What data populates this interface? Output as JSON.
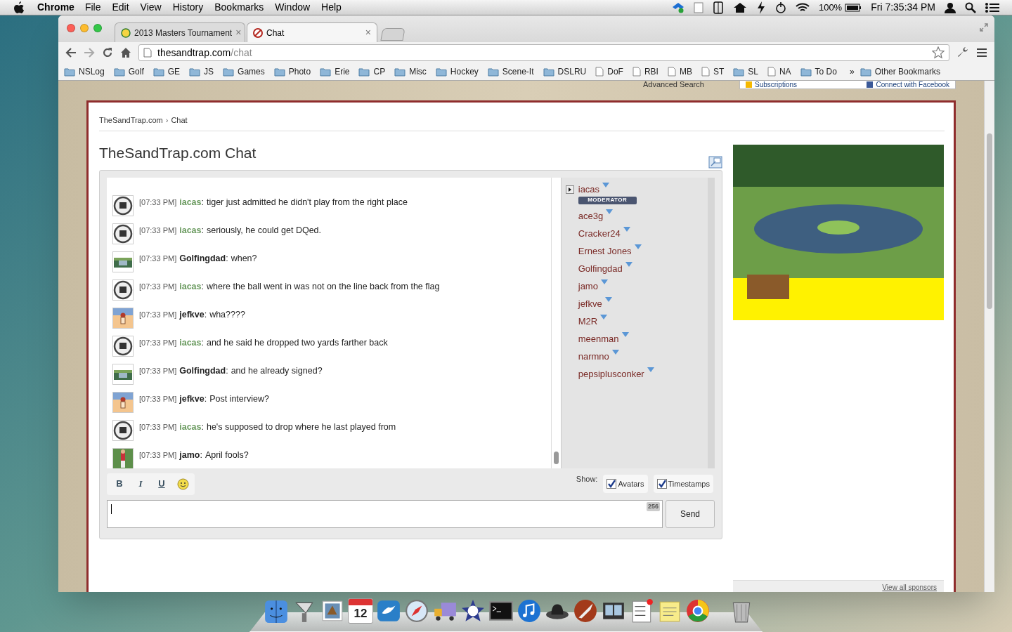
{
  "menubar": {
    "app": "Chrome",
    "items": [
      "File",
      "Edit",
      "View",
      "History",
      "Bookmarks",
      "Window",
      "Help"
    ],
    "battery": "100%",
    "clock": "Fri 7:35:34 PM"
  },
  "browser": {
    "tabs": [
      {
        "title": "2013 Masters Tournament",
        "selected": false,
        "close": "×"
      },
      {
        "title": "Chat",
        "selected": true,
        "close": "×"
      }
    ],
    "url": {
      "host": "thesandtrap.com",
      "path": "/chat"
    },
    "bookmarks": [
      {
        "label": "NSLog",
        "kind": "folder"
      },
      {
        "label": "Golf",
        "kind": "folder"
      },
      {
        "label": "GE",
        "kind": "folder"
      },
      {
        "label": "JS",
        "kind": "folder"
      },
      {
        "label": "Games",
        "kind": "folder"
      },
      {
        "label": "Photo",
        "kind": "folder"
      },
      {
        "label": "Erie",
        "kind": "folder"
      },
      {
        "label": "CP",
        "kind": "folder"
      },
      {
        "label": "Misc",
        "kind": "folder"
      },
      {
        "label": "Hockey",
        "kind": "folder"
      },
      {
        "label": "Scene-It",
        "kind": "folder"
      },
      {
        "label": "DSLRU",
        "kind": "folder"
      },
      {
        "label": "DoF",
        "kind": "page"
      },
      {
        "label": "RBI",
        "kind": "page"
      },
      {
        "label": "MB",
        "kind": "page"
      },
      {
        "label": "ST",
        "kind": "page"
      },
      {
        "label": "SL",
        "kind": "folder"
      },
      {
        "label": "NA",
        "kind": "page"
      },
      {
        "label": "To Do",
        "kind": "folder"
      }
    ],
    "bookmarks_overflow": "»",
    "other_bookmarks": "Other Bookmarks"
  },
  "page": {
    "header": {
      "advanced_search": "Advanced Search",
      "subscriptions": "Subscriptions",
      "facebook": "Connect with Facebook"
    },
    "breadcrumb": [
      "TheSandTrap.com",
      "Chat"
    ],
    "breadcrumb_separator": "›",
    "title": "TheSandTrap.com Chat",
    "messages": [
      {
        "time": "[07:33 PM]",
        "user": "iacas",
        "moderator": true,
        "kind": "badge",
        "separator": ":",
        "text": "tiger just admitted he didn't play from the right place"
      },
      {
        "time": "[07:33 PM]",
        "user": "iacas",
        "moderator": true,
        "kind": "badge",
        "separator": ":",
        "text": "seriously, he could get DQed."
      },
      {
        "time": "[07:33 PM]",
        "user": "Golfingdad",
        "moderator": false,
        "kind": "cart",
        "separator": ":",
        "text": "when?"
      },
      {
        "time": "[07:33 PM]",
        "user": "iacas",
        "moderator": true,
        "kind": "badge",
        "separator": ":",
        "text": "where the ball went in was not on the line back from the flag"
      },
      {
        "time": "[07:33 PM]",
        "user": "jefkve",
        "moderator": false,
        "kind": "cartoon",
        "separator": ":",
        "text": "wha????"
      },
      {
        "time": "[07:33 PM]",
        "user": "iacas",
        "moderator": true,
        "kind": "badge",
        "separator": ":",
        "text": "and he said he dropped two yards farther back"
      },
      {
        "time": "[07:33 PM]",
        "user": "Golfingdad",
        "moderator": false,
        "kind": "cart",
        "separator": ":",
        "text": "and he already signed?"
      },
      {
        "time": "[07:33 PM]",
        "user": "jefkve",
        "moderator": false,
        "kind": "cartoon",
        "separator": ":",
        "text": "Post interview?"
      },
      {
        "time": "[07:33 PM]",
        "user": "iacas",
        "moderator": true,
        "kind": "badge",
        "separator": ":",
        "text": "he's supposed to drop where he last played from"
      },
      {
        "time": "[07:33 PM]",
        "user": "jamo",
        "moderator": false,
        "kind": "golfer",
        "separator": ":",
        "text": "April fools?"
      }
    ],
    "users": [
      {
        "name": "iacas",
        "badge": "MODERATOR"
      },
      {
        "name": "ace3g"
      },
      {
        "name": "Cracker24"
      },
      {
        "name": "Ernest Jones"
      },
      {
        "name": "Golfingdad"
      },
      {
        "name": "jamo"
      },
      {
        "name": "jefkve"
      },
      {
        "name": "M2R"
      },
      {
        "name": "meenman"
      },
      {
        "name": "narmno"
      },
      {
        "name": "pepsiplusconker"
      }
    ],
    "format_buttons": [
      "B",
      "I",
      "U"
    ],
    "show_label": "Show:",
    "toggles": [
      {
        "label": "Avatars",
        "checked": true
      },
      {
        "label": "Timestamps",
        "checked": true
      }
    ],
    "counter": "256",
    "send": "Send",
    "sponsors_link": "View all sponsors"
  },
  "dock": {
    "calendar_day": "12"
  }
}
